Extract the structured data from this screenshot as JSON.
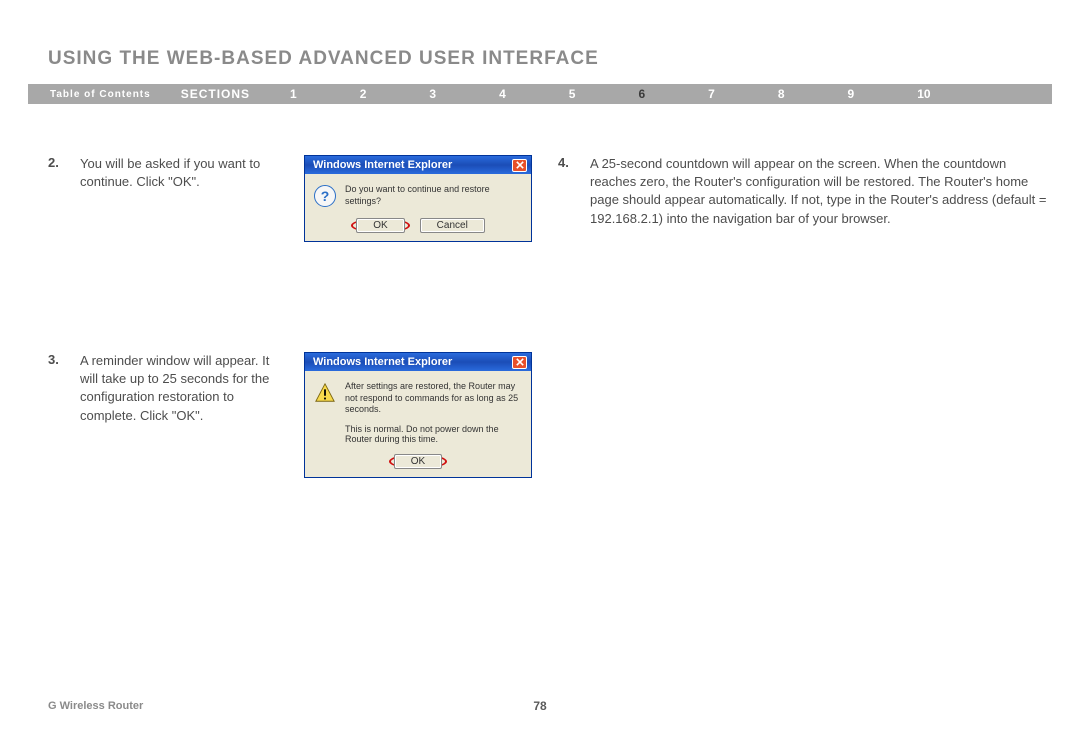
{
  "heading": "USING THE WEB-BASED ADVANCED USER INTERFACE",
  "nav": {
    "toc": "Table of Contents",
    "sections_label": "SECTIONS",
    "items": [
      "1",
      "2",
      "3",
      "4",
      "5",
      "6",
      "7",
      "8",
      "9",
      "10"
    ],
    "active_index": 5
  },
  "steps": {
    "s2": {
      "num": "2.",
      "text": "You will be asked if you want to continue. Click \"OK\"."
    },
    "s3": {
      "num": "3.",
      "text": "A reminder window will appear. It will take up to 25 seconds for the configuration restoration to complete. Click \"OK\"."
    },
    "s4": {
      "num": "4.",
      "text": "A 25-second countdown will appear on the screen. When the countdown reaches zero, the Router's configuration will be restored. The Router's home page should appear automatically. If not, type in the Router's address (default = 192.168.2.1) into the navigation bar of your browser."
    }
  },
  "dialog1": {
    "title": "Windows Internet Explorer",
    "message": "Do you want to continue and restore settings?",
    "ok": "OK",
    "cancel": "Cancel"
  },
  "dialog2": {
    "title": "Windows Internet Explorer",
    "message1": "After settings are restored, the Router may not respond to commands for as long as 25 seconds.",
    "message2": "This is normal. Do not power down the Router during this time.",
    "ok": "OK"
  },
  "footer": {
    "left": "G Wireless Router",
    "page": "78"
  }
}
